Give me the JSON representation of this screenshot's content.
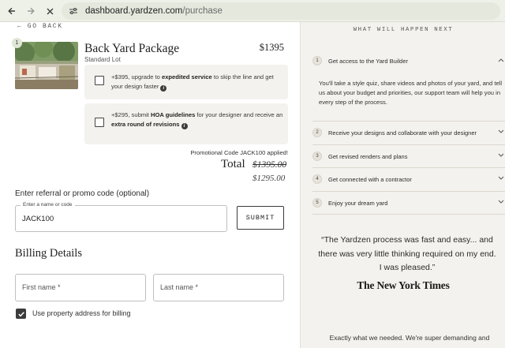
{
  "browser": {
    "url_domain": "dashboard.yardzen.com",
    "url_path": "/purchase"
  },
  "nav": {
    "go_back": "← GO BACK"
  },
  "package": {
    "badge": "1",
    "title": "Back Yard Package",
    "subtitle": "Standard Lot",
    "price": "$1395"
  },
  "addons": [
    {
      "prefix": "+$395, upgrade to ",
      "bold": "expedited service",
      "rest": " to skip the line and get your design faster"
    },
    {
      "prefix": "+$295, submit ",
      "bold": "HOA guidelines",
      "mid": " for your designer and receive an ",
      "bold2": "extra round of revisions",
      "rest": ""
    }
  ],
  "totals": {
    "promo_applied": "Promotional Code JACK100 applied!",
    "label": "Total",
    "old": "$1395.00",
    "new": "$1295.00"
  },
  "promo": {
    "heading": "Enter referral or promo code (optional)",
    "field_label": "Enter a name or code",
    "value": "JACK100",
    "submit": "SUBMIT"
  },
  "billing": {
    "heading": "Billing Details",
    "first_name": "First name *",
    "last_name": "Last name *",
    "use_property": "Use property address for billing",
    "use_property_checked": true
  },
  "next": {
    "heading": "WHAT WILL HAPPEN NEXT",
    "steps": [
      {
        "num": "1",
        "label": "Get access to the Yard Builder",
        "expanded": true
      },
      {
        "num": "2",
        "label": "Receive your designs and collaborate with your designer",
        "expanded": false
      },
      {
        "num": "3",
        "label": "Get revised renders and plans",
        "expanded": false
      },
      {
        "num": "4",
        "label": "Get connected with a contractor",
        "expanded": false
      },
      {
        "num": "5",
        "label": "Enjoy your dream yard",
        "expanded": false
      }
    ],
    "step1_body": "You'll take a style quiz, share videos and photos of your yard, and tell us about your budget and priorities, our support team will help you in every step of the process."
  },
  "testimonial": {
    "quote": "“The Yardzen process was fast and easy... and there was very little thinking required on my end. I was pleased.”",
    "source": "The New York Times",
    "review": "Exactly what we needed. We're super demanding and"
  },
  "colors": {
    "chrome_bg": "#eef1e8",
    "right_panel_bg": "#f4f2ee",
    "checkbox_dark": "#3b3b3b"
  }
}
